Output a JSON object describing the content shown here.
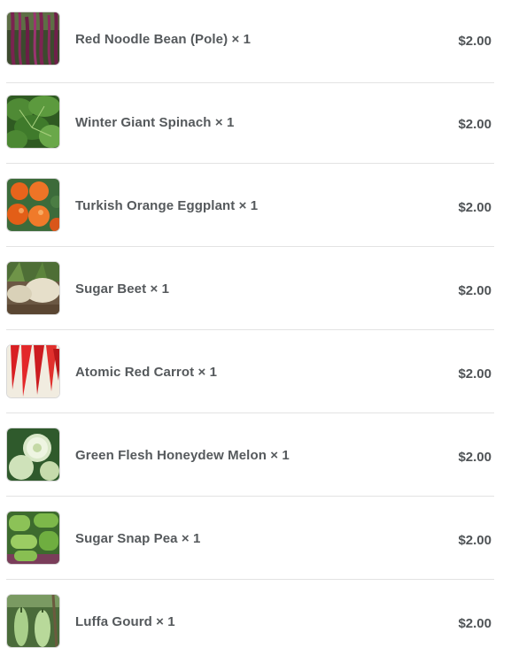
{
  "cart": {
    "items": [
      {
        "name": "Red Noodle Bean (Pole) × 1",
        "price": "$2.00",
        "image_icon": "red-noodle-bean-thumbnail"
      },
      {
        "name": "Winter Giant Spinach × 1",
        "price": "$2.00",
        "image_icon": "winter-giant-spinach-thumbnail"
      },
      {
        "name": "Turkish Orange Eggplant × 1",
        "price": "$2.00",
        "image_icon": "turkish-orange-eggplant-thumbnail"
      },
      {
        "name": "Sugar Beet × 1",
        "price": "$2.00",
        "image_icon": "sugar-beet-thumbnail"
      },
      {
        "name": "Atomic Red Carrot × 1",
        "price": "$2.00",
        "image_icon": "atomic-red-carrot-thumbnail"
      },
      {
        "name": "Green Flesh Honeydew Melon × 1",
        "price": "$2.00",
        "image_icon": "honeydew-melon-thumbnail"
      },
      {
        "name": "Sugar Snap Pea × 1",
        "price": "$2.00",
        "image_icon": "sugar-snap-pea-thumbnail"
      },
      {
        "name": "Luffa Gourd × 1",
        "price": "$2.00",
        "image_icon": "luffa-gourd-thumbnail"
      }
    ]
  }
}
